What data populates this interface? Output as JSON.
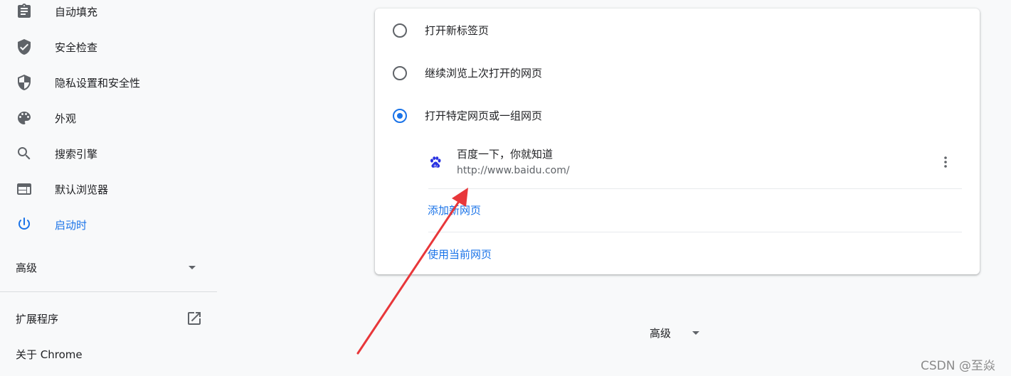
{
  "sidebar": {
    "items": [
      {
        "label": "自动填充",
        "icon": "clipboard-icon"
      },
      {
        "label": "安全检查",
        "icon": "shield-check-icon"
      },
      {
        "label": "隐私设置和安全性",
        "icon": "shield-half-icon"
      },
      {
        "label": "外观",
        "icon": "palette-icon"
      },
      {
        "label": "搜索引擎",
        "icon": "search-icon"
      },
      {
        "label": "默认浏览器",
        "icon": "browser-window-icon"
      },
      {
        "label": "启动时",
        "icon": "power-icon",
        "active": true
      }
    ],
    "advanced_label": "高级",
    "extensions_label": "扩展程序",
    "about_label": "关于 Chrome"
  },
  "startup": {
    "options": [
      {
        "label": "打开新标签页",
        "selected": false
      },
      {
        "label": "继续浏览上次打开的网页",
        "selected": false
      },
      {
        "label": "打开特定网页或一组网页",
        "selected": true
      }
    ],
    "pages": [
      {
        "title": "百度一下，你就知道",
        "url": "http://www.baidu.com/",
        "icon": "baidu-paw-icon"
      }
    ],
    "add_page_label": "添加新网页",
    "use_current_label": "使用当前网页"
  },
  "bottom": {
    "advanced_label": "高级"
  },
  "watermark": "CSDN @至焱",
  "colors": {
    "accent": "#1a73e8",
    "arrow": "#e8373a",
    "background": "#f8f9fa"
  }
}
